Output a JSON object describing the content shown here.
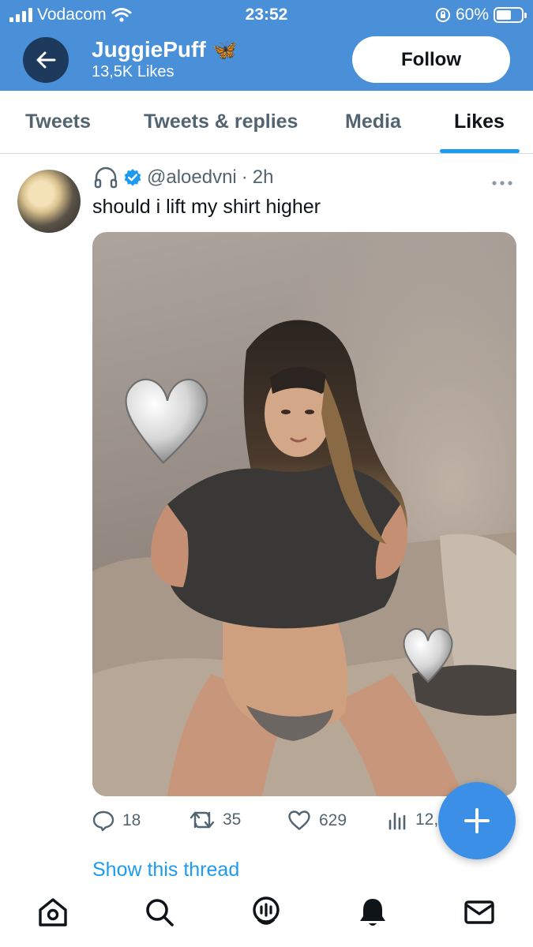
{
  "status_bar": {
    "carrier": "Vodacom",
    "time": "23:52",
    "battery": "60%",
    "battery_level": 0.6
  },
  "header": {
    "name": "JuggiePuff",
    "name_emoji": "🦋",
    "subtitle": "13,5K Likes",
    "follow_label": "Follow",
    "back_icon": "arrow-left-icon"
  },
  "tabs": [
    {
      "label": "Tweets"
    },
    {
      "label": "Tweets & replies"
    },
    {
      "label": "Media"
    },
    {
      "label": "Likes"
    }
  ],
  "active_tab": "Likes",
  "tweet": {
    "handle": "@aloedvni",
    "separator": "·",
    "time": "2h",
    "text": "should i lift my shirt higher",
    "replies": "18",
    "retweets": "35",
    "likes": "629",
    "views": "12,",
    "show_thread": "Show this thread"
  },
  "bottom_nav": [
    "home-icon",
    "search-icon",
    "spaces-icon",
    "notifications-icon",
    "messages-icon"
  ],
  "colors": {
    "header_bg": "#4a90d9",
    "accent": "#1d9bf0",
    "fab": "#3b8fe6",
    "back_button": "#1d3a5c",
    "muted_text": "#536471"
  }
}
